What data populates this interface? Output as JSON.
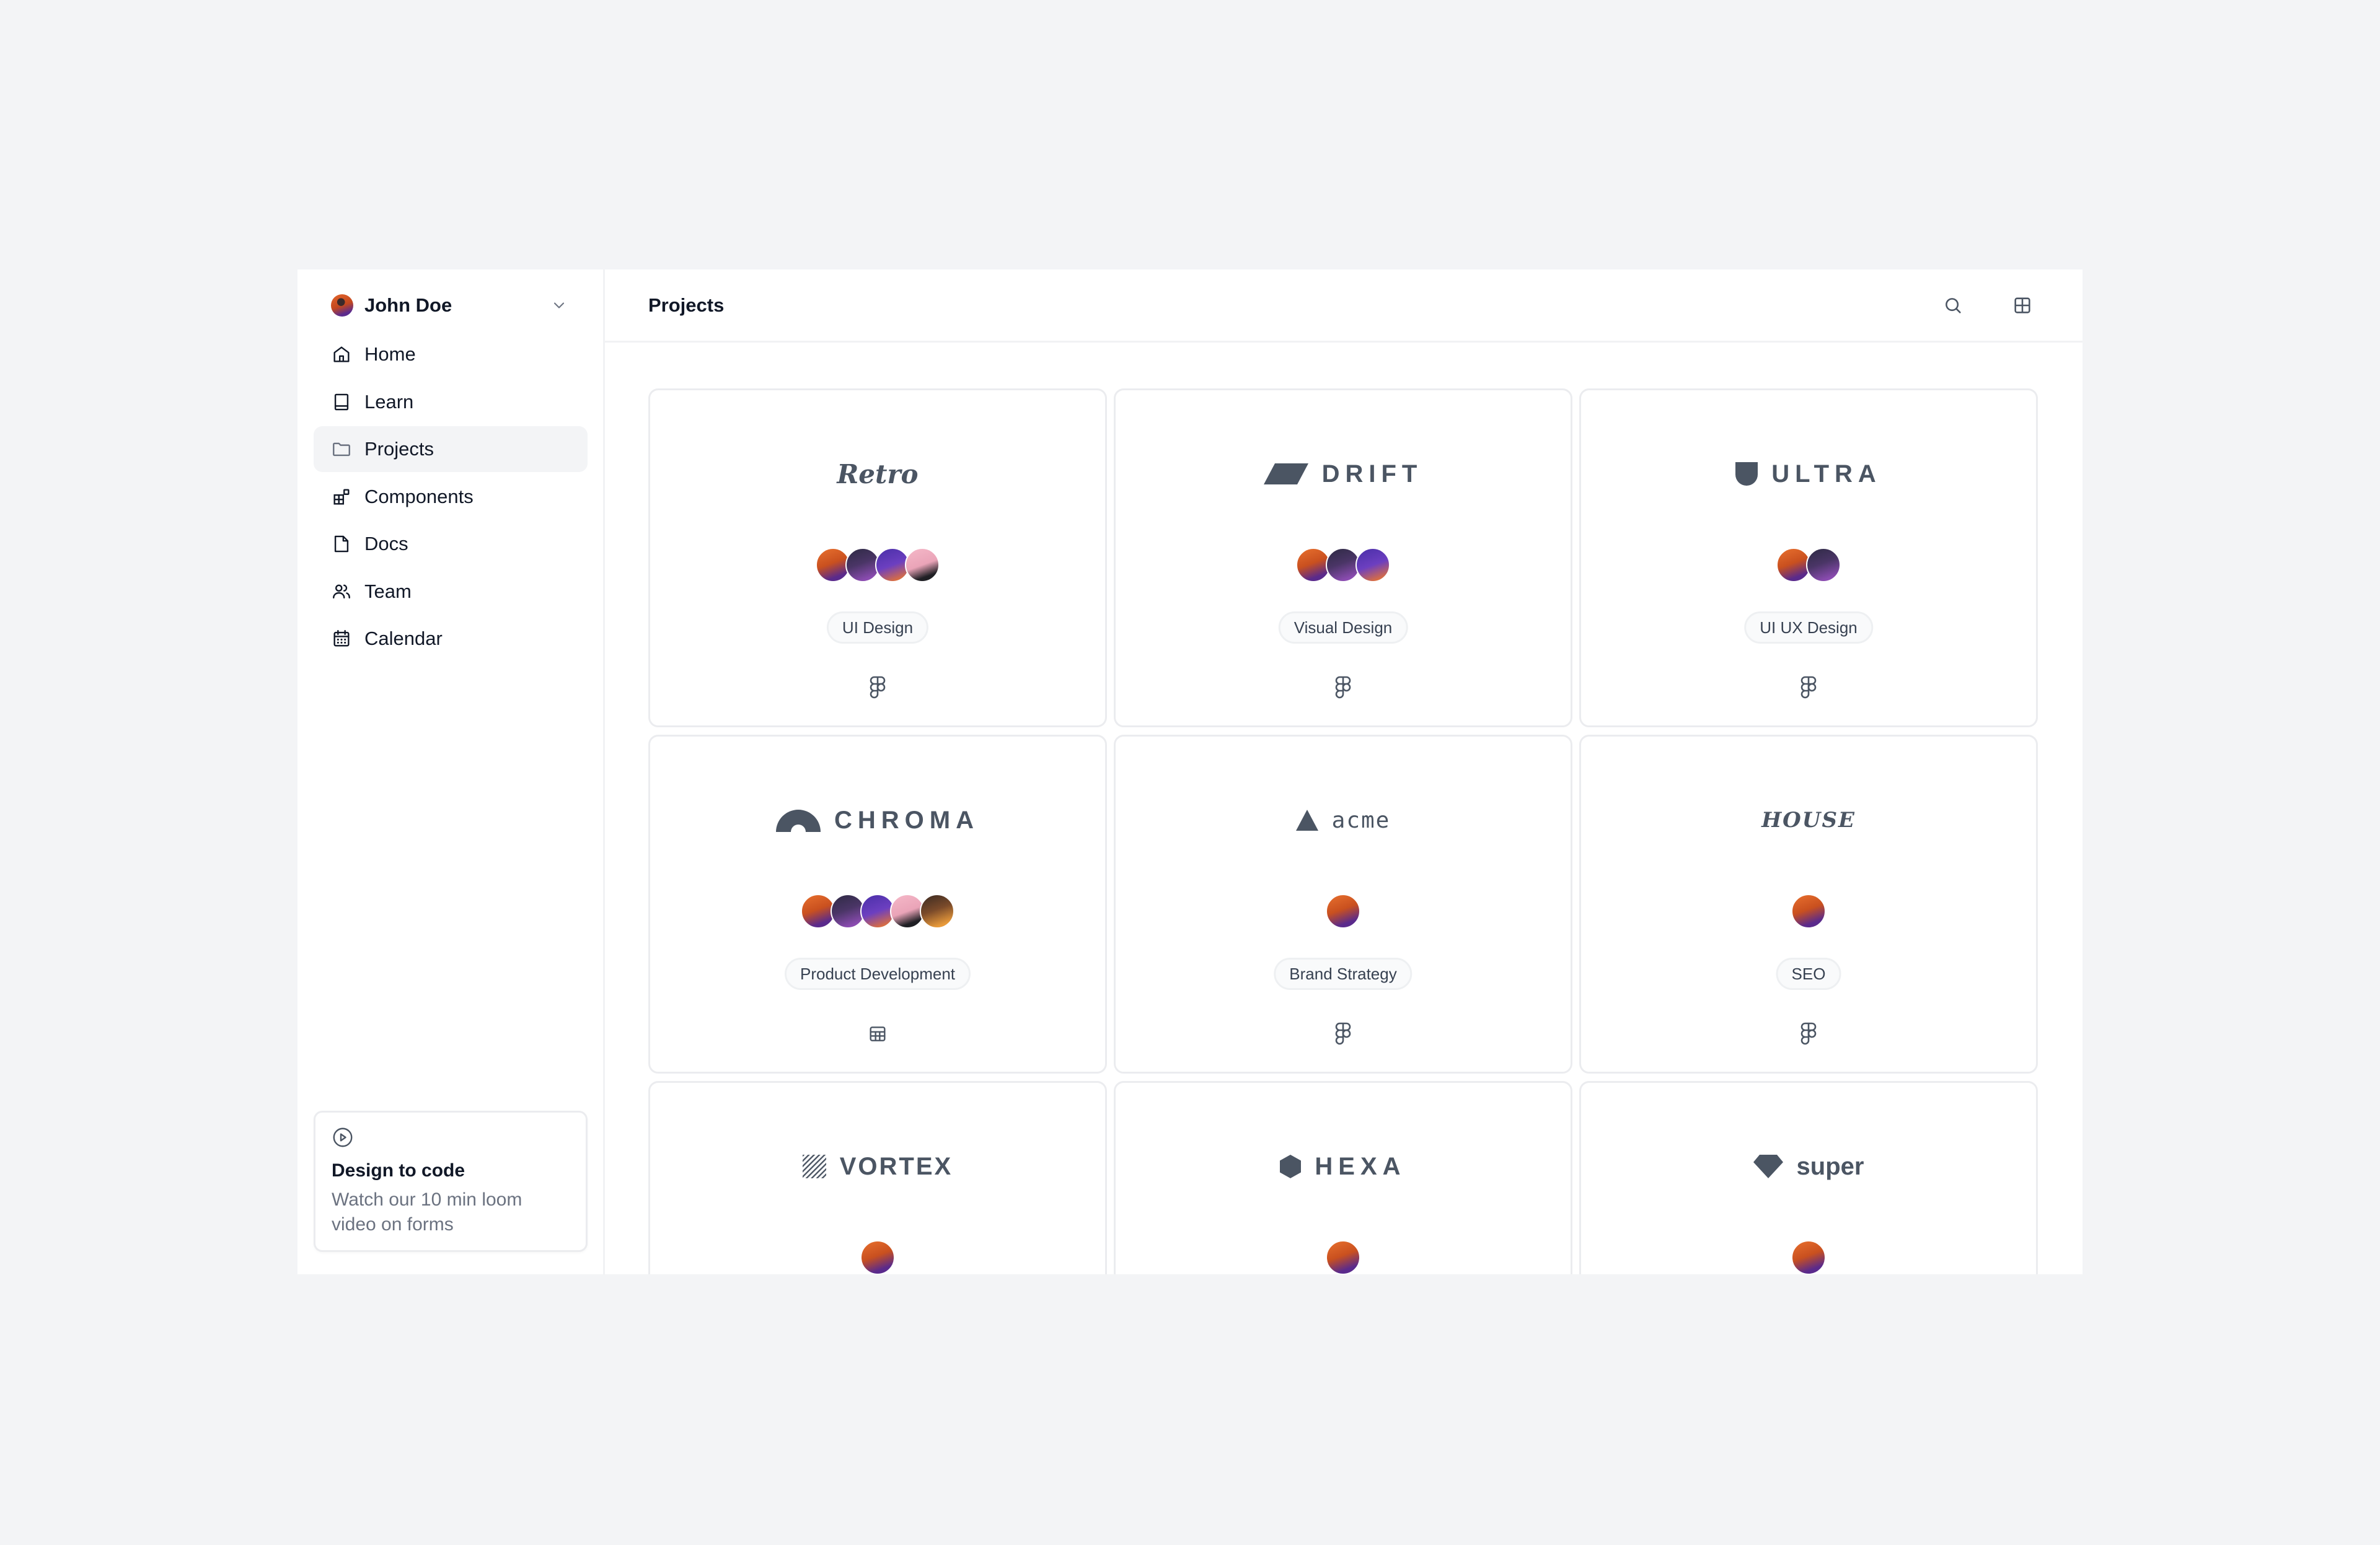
{
  "user": {
    "name": "John Doe"
  },
  "sidebar": {
    "items": [
      {
        "label": "Home",
        "icon": "home-icon",
        "active": false
      },
      {
        "label": "Learn",
        "icon": "book-icon",
        "active": false
      },
      {
        "label": "Projects",
        "icon": "folder-icon",
        "active": true
      },
      {
        "label": "Components",
        "icon": "components-icon",
        "active": false
      },
      {
        "label": "Docs",
        "icon": "document-icon",
        "active": false
      },
      {
        "label": "Team",
        "icon": "users-icon",
        "active": false
      },
      {
        "label": "Calendar",
        "icon": "calendar-icon",
        "active": false
      }
    ],
    "promo": {
      "icon": "play-circle-icon",
      "title": "Design to code",
      "description": "Watch our 10 min loom video on forms"
    }
  },
  "header": {
    "title": "Projects",
    "actions": [
      {
        "name": "search-icon"
      },
      {
        "name": "grid-view-icon"
      }
    ]
  },
  "projects": [
    {
      "name": "Retro",
      "logo": "script",
      "members": 4,
      "tag": "UI Design",
      "tool": "figma-icon"
    },
    {
      "name": "DRIFT",
      "logo": "parallelogram",
      "members": 3,
      "tag": "Visual Design",
      "tool": "figma-icon"
    },
    {
      "name": "ULTRA",
      "logo": "shield",
      "members": 2,
      "tag": "UI UX Design",
      "tool": "figma-icon"
    },
    {
      "name": "CHROMA",
      "logo": "arch",
      "members": 5,
      "tag": "Product Development",
      "tool": "table-icon"
    },
    {
      "name": "acme",
      "logo": "triangle",
      "members": 1,
      "tag": "Brand Strategy",
      "tool": "figma-icon"
    },
    {
      "name": "HOUSE",
      "logo": "gothic",
      "members": 1,
      "tag": "SEO",
      "tool": "figma-icon"
    },
    {
      "name": "VORTEX",
      "logo": "stripes",
      "members": 1,
      "tag": "",
      "tool": ""
    },
    {
      "name": "HEXA",
      "logo": "hexagon",
      "members": 1,
      "tag": "",
      "tool": ""
    },
    {
      "name": "super",
      "logo": "diamond",
      "members": 1,
      "tag": "",
      "tool": ""
    }
  ]
}
